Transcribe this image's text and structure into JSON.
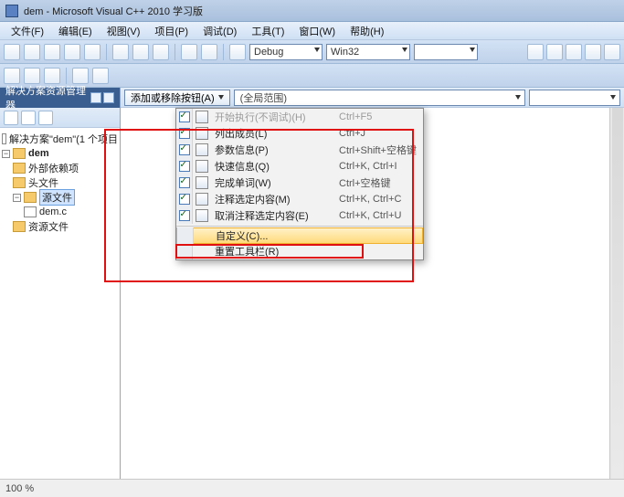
{
  "title": "dem - Microsoft Visual C++ 2010 学习版",
  "menu": [
    "文件(F)",
    "编辑(E)",
    "视图(V)",
    "项目(P)",
    "调试(D)",
    "工具(T)",
    "窗口(W)",
    "帮助(H)"
  ],
  "combo": {
    "debug": "Debug",
    "win32": "Win32"
  },
  "sidebar": {
    "title": "解决方案资源管理器",
    "tree": {
      "solution": "解决方案\"dem\"(1 个项目",
      "project": "dem",
      "folders": [
        "外部依赖项",
        "头文件",
        "源文件",
        "资源文件"
      ],
      "src": "dem.c"
    }
  },
  "nav": {
    "dropbtn": "添加或移除按钮(A)",
    "scope": "(全局范围)"
  },
  "dropdown": [
    {
      "chk": true,
      "lbl": "开始执行(不调试)(H)",
      "key": "Ctrl+F5",
      "dis": true
    },
    {
      "chk": true,
      "lbl": "列出成员(L)",
      "key": "Ctrl+J"
    },
    {
      "chk": true,
      "lbl": "参数信息(P)",
      "key": "Ctrl+Shift+空格键"
    },
    {
      "chk": true,
      "lbl": "快速信息(Q)",
      "key": "Ctrl+K, Ctrl+I"
    },
    {
      "chk": true,
      "lbl": "完成单词(W)",
      "key": "Ctrl+空格键"
    },
    {
      "chk": true,
      "lbl": "注释选定内容(M)",
      "key": "Ctrl+K, Ctrl+C"
    },
    {
      "chk": true,
      "lbl": "取消注释选定内容(E)",
      "key": "Ctrl+K, Ctrl+U"
    },
    {
      "sep": true
    },
    {
      "hl": true,
      "lbl": "自定义(C)...",
      "key": ""
    },
    {
      "lbl": "重置工具栏(R)",
      "key": ""
    }
  ],
  "status": {
    "zoom": "100 %"
  }
}
